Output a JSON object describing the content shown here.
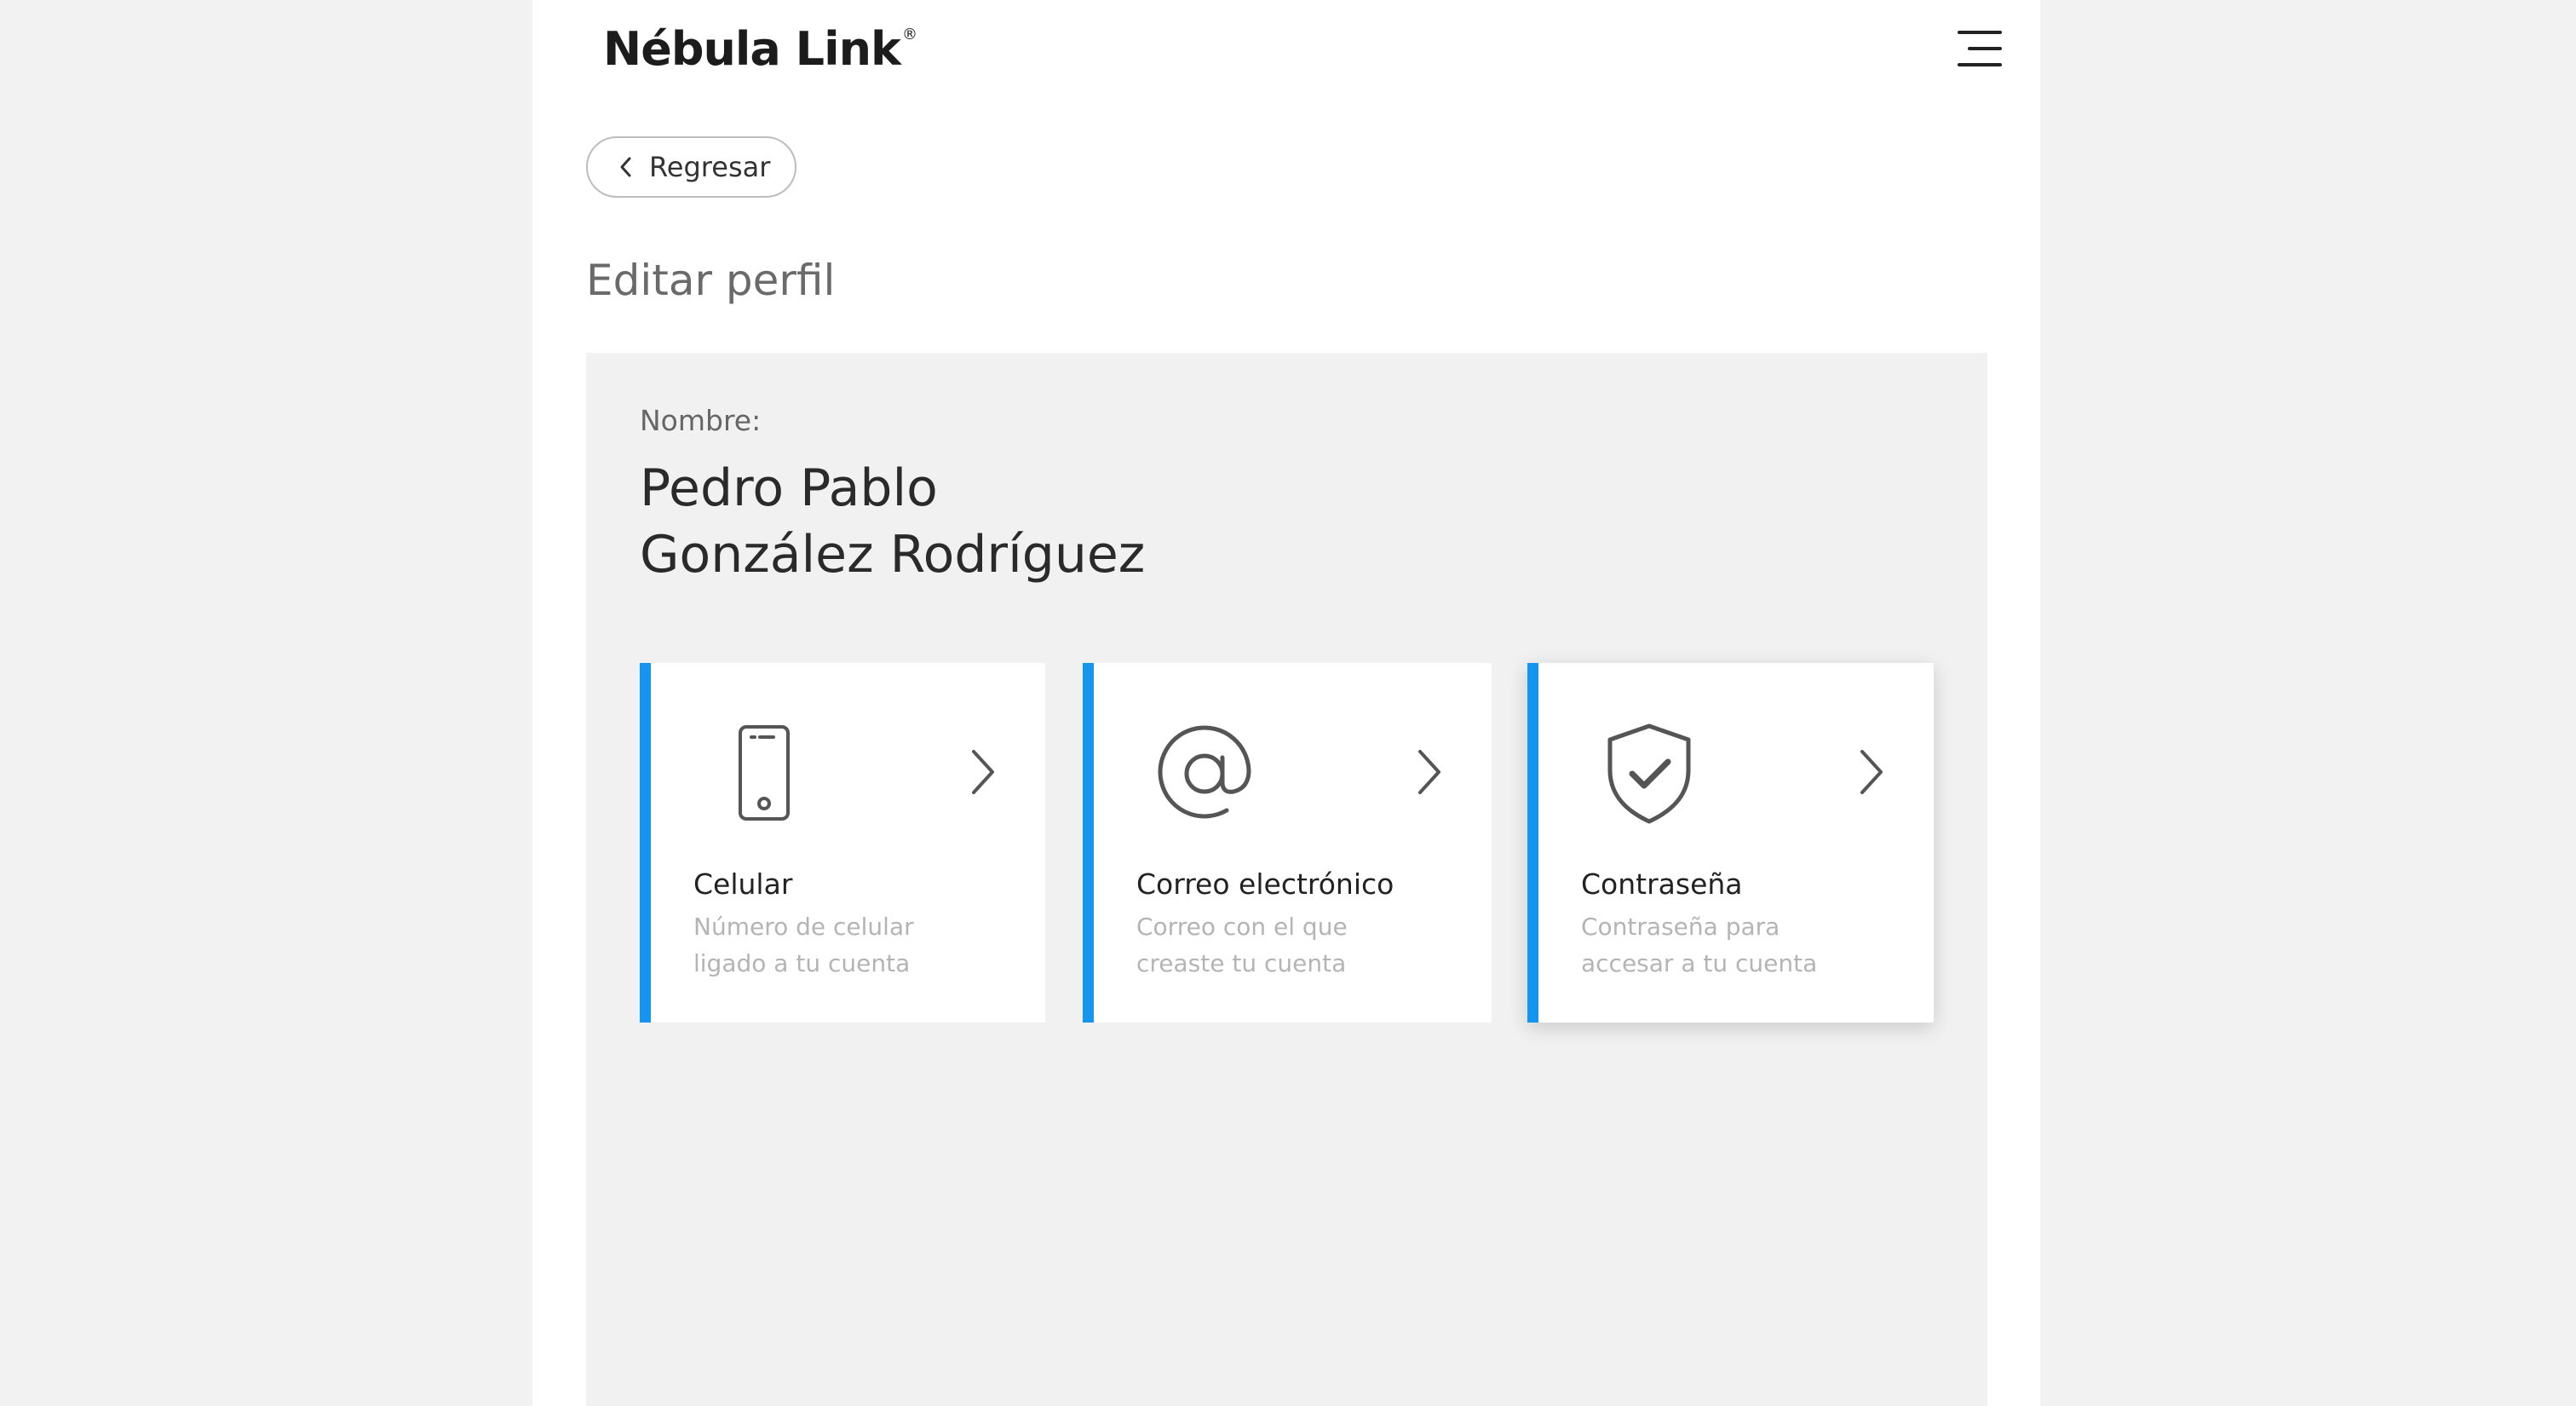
{
  "brand": {
    "name": "Nébula Link",
    "mark": "®"
  },
  "header": {
    "menu_icon": "hamburger-menu-icon"
  },
  "back_button": {
    "label": "Regresar",
    "icon": "chevron-left-icon"
  },
  "page_title": "Editar perfil",
  "profile": {
    "name_label": "Nombre:",
    "name_line_1": "Pedro Pablo",
    "name_line_2": "González Rodríguez"
  },
  "cards": [
    {
      "title": "Celular",
      "desc_line_1": "Número de celular",
      "desc_line_2": "ligado a tu cuenta",
      "icon": "mobile-phone-icon"
    },
    {
      "title": "Correo electrónico",
      "desc_line_1": "Correo con el que",
      "desc_line_2": "creaste tu cuenta",
      "icon": "at-sign-icon"
    },
    {
      "title": "Contraseña",
      "desc_line_1": "Contraseña para",
      "desc_line_2": "accesar a tu cuenta",
      "icon": "shield-check-icon"
    }
  ],
  "colors": {
    "accent": "#1496f0",
    "background": "#f2f2f2",
    "panel": "#f1f1f1",
    "card": "#ffffff"
  }
}
